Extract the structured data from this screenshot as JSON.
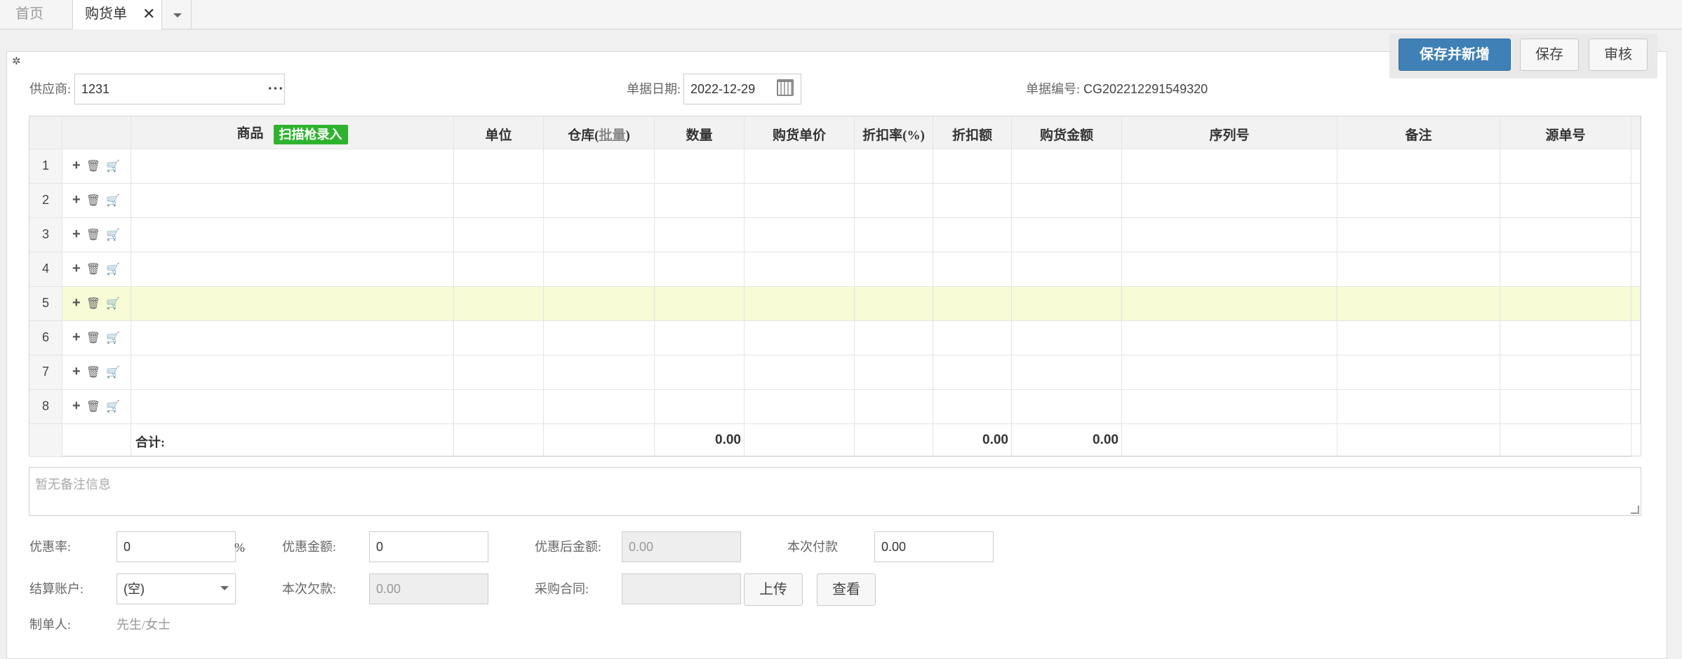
{
  "tabs": {
    "home": "首页",
    "active": "购货单",
    "close_glyph": "✕"
  },
  "toolbar": {
    "save_new": "保存并新增",
    "save": "保存",
    "audit": "审核"
  },
  "header": {
    "supplier_label": "供应商:",
    "supplier_value": "1231",
    "supplier_more": "···",
    "date_label": "单据日期:",
    "date_value": "2022-12-29",
    "docno_label": "单据编号:",
    "docno_value": "CG202212291549320"
  },
  "grid": {
    "col_product": "商品",
    "scan_btn": "扫描枪录入",
    "col_unit": "单位",
    "col_warehouse": "仓库(",
    "col_batch": "批量",
    "col_warehouse_end": ")",
    "col_qty": "数量",
    "col_price": "购货单价",
    "col_discount_rate": "折扣率(%)",
    "col_discount_amt": "折扣额",
    "col_amount": "购货金额",
    "col_serial": "序列号",
    "col_note": "备注",
    "col_source": "源单号",
    "rows": [
      "1",
      "2",
      "3",
      "4",
      "5",
      "6",
      "7",
      "8"
    ],
    "total_label": "合计:",
    "total_qty": "0.00",
    "total_discount": "0.00",
    "total_amount": "0.00"
  },
  "memo": {
    "placeholder": "暂无备注信息"
  },
  "footer": {
    "rate_label": "优惠率:",
    "rate_value": "0",
    "rate_unit": "%",
    "discount_label": "优惠金额:",
    "discount_value": "0",
    "after_label": "优惠后金额:",
    "after_value": "0.00",
    "paid_label": "本次付款",
    "paid_value": "0.00",
    "account_label": "结算账户:",
    "account_value": "(空)",
    "owed_label": "本次欠款:",
    "owed_value": "0.00",
    "contract_label": "采购合同:",
    "upload": "上传",
    "view": "查看",
    "maker_label": "制单人:",
    "maker_value": "先生/女士"
  },
  "colors": {
    "primary": "#3f80b6",
    "scan_green": "#2fb32f",
    "highlight_row": "#f7fbd6"
  }
}
